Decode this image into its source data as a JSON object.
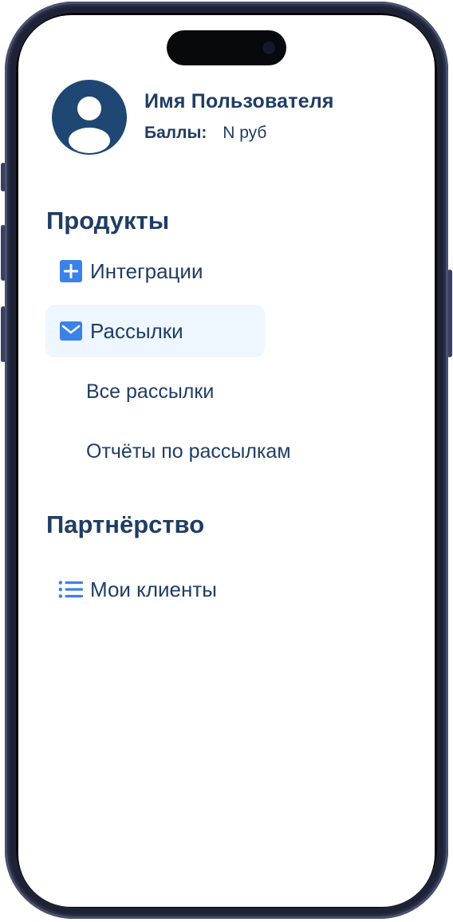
{
  "profile": {
    "name": "Имя Пользователя",
    "points_label": "Баллы:",
    "points_value": "N руб"
  },
  "sections": {
    "products": {
      "title": "Продукты",
      "items": [
        {
          "label": "Интеграции",
          "icon": "plus-square-icon"
        },
        {
          "label": "Рассылки",
          "icon": "envelope-icon",
          "active": true
        }
      ],
      "subitems": [
        "Все рассылки",
        "Отчёты по рассылкам"
      ]
    },
    "partnership": {
      "title": "Партнёрство",
      "items": [
        {
          "label": "Мои клиенты",
          "icon": "list-icon"
        }
      ]
    }
  },
  "colors": {
    "text": "#1f3d63",
    "icon_blue": "#3b82e8",
    "active_bg": "#eef6ff",
    "avatar_bg": "#1f4774",
    "frame": "#1e2235"
  }
}
